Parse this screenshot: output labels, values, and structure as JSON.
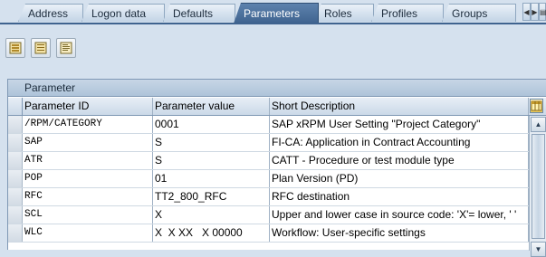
{
  "tabs": [
    {
      "label": "Address"
    },
    {
      "label": "Logon data"
    },
    {
      "label": "Defaults"
    },
    {
      "label": "Parameters"
    },
    {
      "label": "Roles"
    },
    {
      "label": "Profiles"
    },
    {
      "label": "Groups"
    }
  ],
  "active_tab": "Parameters",
  "toolbar": {
    "buttons": [
      {
        "icon": "select-all-icon"
      },
      {
        "icon": "deselect-all-icon"
      },
      {
        "icon": "details-icon"
      }
    ]
  },
  "table": {
    "caption": "Parameter",
    "columns": [
      "Parameter ID",
      "Parameter value",
      "Short Description"
    ],
    "rows": [
      {
        "id": "/RPM/CATEGORY",
        "value": "0001",
        "desc": "SAP xRPM User Setting \"Project Category\""
      },
      {
        "id": "SAP",
        "value": "S",
        "desc": "FI-CA: Application in Contract Accounting"
      },
      {
        "id": "ATR",
        "value": "S",
        "desc": "CATT - Procedure or test module type"
      },
      {
        "id": "POP",
        "value": "01",
        "desc": "Plan Version (PD)"
      },
      {
        "id": "RFC",
        "value": "TT2_800_RFC",
        "desc": "RFC destination"
      },
      {
        "id": "SCL",
        "value": "X",
        "desc": "Upper and lower case in source code: 'X'= lower, ' '"
      },
      {
        "id": "WLC",
        "value": "X  X XX   X 00000",
        "desc": "Workflow: User-specific settings"
      }
    ]
  },
  "colors": {
    "active_tab": "#3f638f",
    "caption_bg": "#aec3d9",
    "window_bg": "#d5e1ee"
  }
}
